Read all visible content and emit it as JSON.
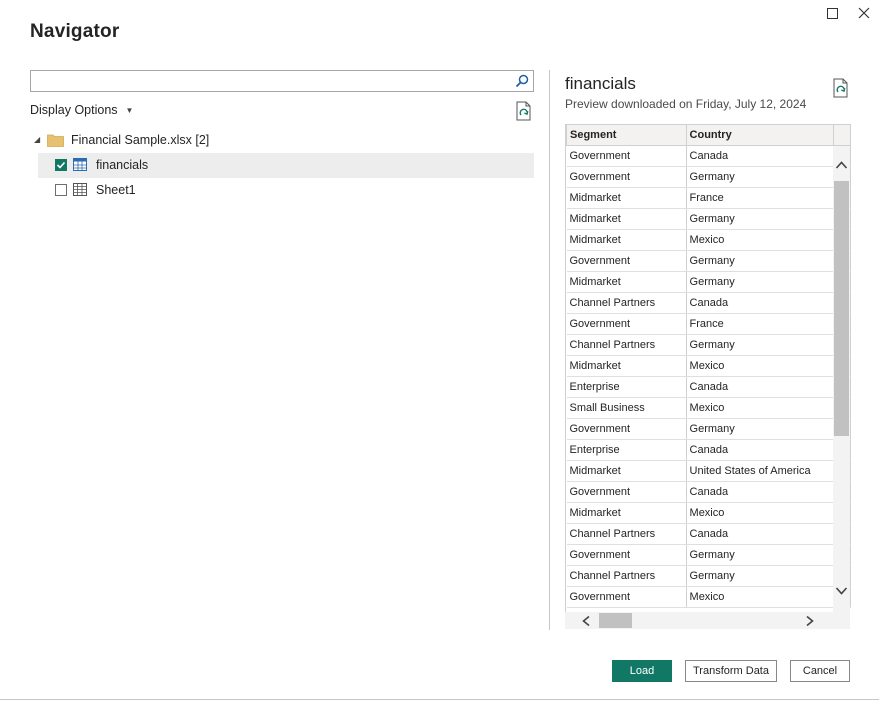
{
  "window": {
    "title": "Navigator",
    "controls": {
      "maximize_icon": "maximize-icon",
      "close_icon": "close-icon"
    }
  },
  "left_pane": {
    "search": {
      "value": "",
      "placeholder": ""
    },
    "display_options_label": "Display Options",
    "tree": {
      "root": {
        "label": "Financial Sample.xlsx [2]",
        "expanded": true,
        "icon": "folder-icon"
      },
      "items": [
        {
          "label": "financials",
          "checked": true,
          "selected": true,
          "icon": "table-icon"
        },
        {
          "label": "Sheet1",
          "checked": false,
          "selected": false,
          "icon": "sheet-icon"
        }
      ]
    }
  },
  "preview": {
    "title": "financials",
    "subtitle": "Preview downloaded on Friday, July 12, 2024",
    "columns": [
      "Segment",
      "Country",
      ""
    ],
    "rows": [
      [
        "Government",
        "Canada"
      ],
      [
        "Government",
        "Germany"
      ],
      [
        "Midmarket",
        "France"
      ],
      [
        "Midmarket",
        "Germany"
      ],
      [
        "Midmarket",
        "Mexico"
      ],
      [
        "Government",
        "Germany"
      ],
      [
        "Midmarket",
        "Germany"
      ],
      [
        "Channel Partners",
        "Canada"
      ],
      [
        "Government",
        "France"
      ],
      [
        "Channel Partners",
        "Germany"
      ],
      [
        "Midmarket",
        "Mexico"
      ],
      [
        "Enterprise",
        "Canada"
      ],
      [
        "Small Business",
        "Mexico"
      ],
      [
        "Government",
        "Germany"
      ],
      [
        "Enterprise",
        "Canada"
      ],
      [
        "Midmarket",
        "United States of America"
      ],
      [
        "Government",
        "Canada"
      ],
      [
        "Midmarket",
        "Mexico"
      ],
      [
        "Channel Partners",
        "Canada"
      ],
      [
        "Government",
        "Germany"
      ],
      [
        "Channel Partners",
        "Germany"
      ],
      [
        "Government",
        "Mexico"
      ]
    ]
  },
  "buttons": {
    "load": "Load",
    "transform": "Transform Data",
    "cancel": "Cancel"
  },
  "colors": {
    "accent": "#117865",
    "selected_row": "#ededed",
    "folder": "#e8c071"
  }
}
